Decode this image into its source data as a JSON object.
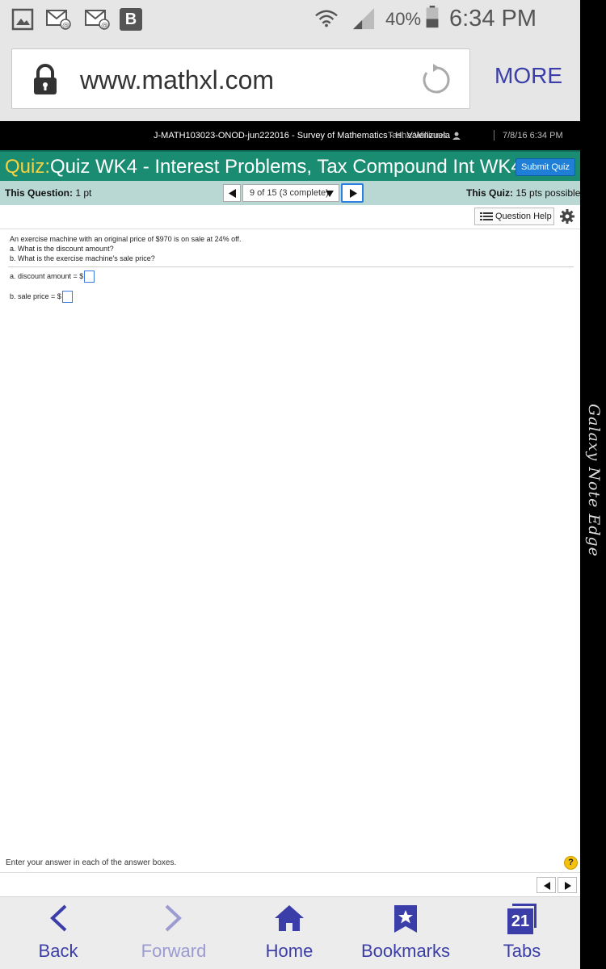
{
  "status_bar": {
    "battery": "40%",
    "time": "6:34 PM",
    "notification_badge": "B"
  },
  "browser": {
    "url": "www.mathxl.com",
    "more_label": "MORE"
  },
  "edge_panel": {
    "text": "Galaxy Note Edge"
  },
  "course": {
    "title": "J-MATH103023-ONOD-jun222016 - Survey of Mathematics - H. Valenzuela",
    "student": "Tasha Williams",
    "date": "7/8/16 6:34 PM"
  },
  "quiz": {
    "label": "Quiz:",
    "title": "Quiz WK4 - Interest Problems, Tax Compound Int WK4",
    "submit_label": "Submit Quiz"
  },
  "question_info": {
    "this_question_label": "This Question:",
    "this_question_value": "1 pt",
    "position": "9 of 15 (3 complete)",
    "this_quiz_label": "This Quiz:",
    "this_quiz_value": "15 pts possible"
  },
  "help": {
    "label": "Question Help"
  },
  "question": {
    "prompt": "An exercise machine with an original price of $970 is on sale at 24% off.",
    "part_a": "a. What is the discount amount?",
    "part_b": "b. What is the exercise machine's sale price?",
    "answer_a_label": "a. discount amount = $",
    "answer_b_label": "b.  sale price = $"
  },
  "footer": {
    "instruction": "Enter your answer in each of the answer boxes.",
    "help_symbol": "?"
  },
  "bottom_nav": {
    "back": "Back",
    "forward": "Forward",
    "home": "Home",
    "bookmarks": "Bookmarks",
    "tabs": "Tabs",
    "tabs_count": "21"
  },
  "colors": {
    "quiz_bar": "#1a8c72",
    "quiz_label": "#f7d23e",
    "info_bar": "#b9d8d4",
    "accent_blue": "#1f7fd6",
    "browser_purple": "#3b3ea8"
  }
}
